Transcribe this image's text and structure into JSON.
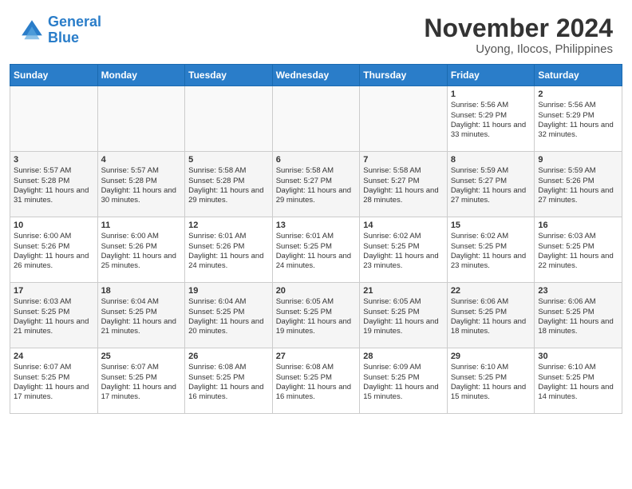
{
  "header": {
    "logo_line1": "General",
    "logo_line2": "Blue",
    "title": "November 2024",
    "subtitle": "Uyong, Ilocos, Philippines"
  },
  "weekdays": [
    "Sunday",
    "Monday",
    "Tuesday",
    "Wednesday",
    "Thursday",
    "Friday",
    "Saturday"
  ],
  "weeks": [
    [
      {
        "day": "",
        "sunrise": "",
        "sunset": "",
        "daylight": ""
      },
      {
        "day": "",
        "sunrise": "",
        "sunset": "",
        "daylight": ""
      },
      {
        "day": "",
        "sunrise": "",
        "sunset": "",
        "daylight": ""
      },
      {
        "day": "",
        "sunrise": "",
        "sunset": "",
        "daylight": ""
      },
      {
        "day": "",
        "sunrise": "",
        "sunset": "",
        "daylight": ""
      },
      {
        "day": "1",
        "sunrise": "Sunrise: 5:56 AM",
        "sunset": "Sunset: 5:29 PM",
        "daylight": "Daylight: 11 hours and 33 minutes."
      },
      {
        "day": "2",
        "sunrise": "Sunrise: 5:56 AM",
        "sunset": "Sunset: 5:29 PM",
        "daylight": "Daylight: 11 hours and 32 minutes."
      }
    ],
    [
      {
        "day": "3",
        "sunrise": "Sunrise: 5:57 AM",
        "sunset": "Sunset: 5:28 PM",
        "daylight": "Daylight: 11 hours and 31 minutes."
      },
      {
        "day": "4",
        "sunrise": "Sunrise: 5:57 AM",
        "sunset": "Sunset: 5:28 PM",
        "daylight": "Daylight: 11 hours and 30 minutes."
      },
      {
        "day": "5",
        "sunrise": "Sunrise: 5:58 AM",
        "sunset": "Sunset: 5:28 PM",
        "daylight": "Daylight: 11 hours and 29 minutes."
      },
      {
        "day": "6",
        "sunrise": "Sunrise: 5:58 AM",
        "sunset": "Sunset: 5:27 PM",
        "daylight": "Daylight: 11 hours and 29 minutes."
      },
      {
        "day": "7",
        "sunrise": "Sunrise: 5:58 AM",
        "sunset": "Sunset: 5:27 PM",
        "daylight": "Daylight: 11 hours and 28 minutes."
      },
      {
        "day": "8",
        "sunrise": "Sunrise: 5:59 AM",
        "sunset": "Sunset: 5:27 PM",
        "daylight": "Daylight: 11 hours and 27 minutes."
      },
      {
        "day": "9",
        "sunrise": "Sunrise: 5:59 AM",
        "sunset": "Sunset: 5:26 PM",
        "daylight": "Daylight: 11 hours and 27 minutes."
      }
    ],
    [
      {
        "day": "10",
        "sunrise": "Sunrise: 6:00 AM",
        "sunset": "Sunset: 5:26 PM",
        "daylight": "Daylight: 11 hours and 26 minutes."
      },
      {
        "day": "11",
        "sunrise": "Sunrise: 6:00 AM",
        "sunset": "Sunset: 5:26 PM",
        "daylight": "Daylight: 11 hours and 25 minutes."
      },
      {
        "day": "12",
        "sunrise": "Sunrise: 6:01 AM",
        "sunset": "Sunset: 5:26 PM",
        "daylight": "Daylight: 11 hours and 24 minutes."
      },
      {
        "day": "13",
        "sunrise": "Sunrise: 6:01 AM",
        "sunset": "Sunset: 5:25 PM",
        "daylight": "Daylight: 11 hours and 24 minutes."
      },
      {
        "day": "14",
        "sunrise": "Sunrise: 6:02 AM",
        "sunset": "Sunset: 5:25 PM",
        "daylight": "Daylight: 11 hours and 23 minutes."
      },
      {
        "day": "15",
        "sunrise": "Sunrise: 6:02 AM",
        "sunset": "Sunset: 5:25 PM",
        "daylight": "Daylight: 11 hours and 23 minutes."
      },
      {
        "day": "16",
        "sunrise": "Sunrise: 6:03 AM",
        "sunset": "Sunset: 5:25 PM",
        "daylight": "Daylight: 11 hours and 22 minutes."
      }
    ],
    [
      {
        "day": "17",
        "sunrise": "Sunrise: 6:03 AM",
        "sunset": "Sunset: 5:25 PM",
        "daylight": "Daylight: 11 hours and 21 minutes."
      },
      {
        "day": "18",
        "sunrise": "Sunrise: 6:04 AM",
        "sunset": "Sunset: 5:25 PM",
        "daylight": "Daylight: 11 hours and 21 minutes."
      },
      {
        "day": "19",
        "sunrise": "Sunrise: 6:04 AM",
        "sunset": "Sunset: 5:25 PM",
        "daylight": "Daylight: 11 hours and 20 minutes."
      },
      {
        "day": "20",
        "sunrise": "Sunrise: 6:05 AM",
        "sunset": "Sunset: 5:25 PM",
        "daylight": "Daylight: 11 hours and 19 minutes."
      },
      {
        "day": "21",
        "sunrise": "Sunrise: 6:05 AM",
        "sunset": "Sunset: 5:25 PM",
        "daylight": "Daylight: 11 hours and 19 minutes."
      },
      {
        "day": "22",
        "sunrise": "Sunrise: 6:06 AM",
        "sunset": "Sunset: 5:25 PM",
        "daylight": "Daylight: 11 hours and 18 minutes."
      },
      {
        "day": "23",
        "sunrise": "Sunrise: 6:06 AM",
        "sunset": "Sunset: 5:25 PM",
        "daylight": "Daylight: 11 hours and 18 minutes."
      }
    ],
    [
      {
        "day": "24",
        "sunrise": "Sunrise: 6:07 AM",
        "sunset": "Sunset: 5:25 PM",
        "daylight": "Daylight: 11 hours and 17 minutes."
      },
      {
        "day": "25",
        "sunrise": "Sunrise: 6:07 AM",
        "sunset": "Sunset: 5:25 PM",
        "daylight": "Daylight: 11 hours and 17 minutes."
      },
      {
        "day": "26",
        "sunrise": "Sunrise: 6:08 AM",
        "sunset": "Sunset: 5:25 PM",
        "daylight": "Daylight: 11 hours and 16 minutes."
      },
      {
        "day": "27",
        "sunrise": "Sunrise: 6:08 AM",
        "sunset": "Sunset: 5:25 PM",
        "daylight": "Daylight: 11 hours and 16 minutes."
      },
      {
        "day": "28",
        "sunrise": "Sunrise: 6:09 AM",
        "sunset": "Sunset: 5:25 PM",
        "daylight": "Daylight: 11 hours and 15 minutes."
      },
      {
        "day": "29",
        "sunrise": "Sunrise: 6:10 AM",
        "sunset": "Sunset: 5:25 PM",
        "daylight": "Daylight: 11 hours and 15 minutes."
      },
      {
        "day": "30",
        "sunrise": "Sunrise: 6:10 AM",
        "sunset": "Sunset: 5:25 PM",
        "daylight": "Daylight: 11 hours and 14 minutes."
      }
    ]
  ]
}
